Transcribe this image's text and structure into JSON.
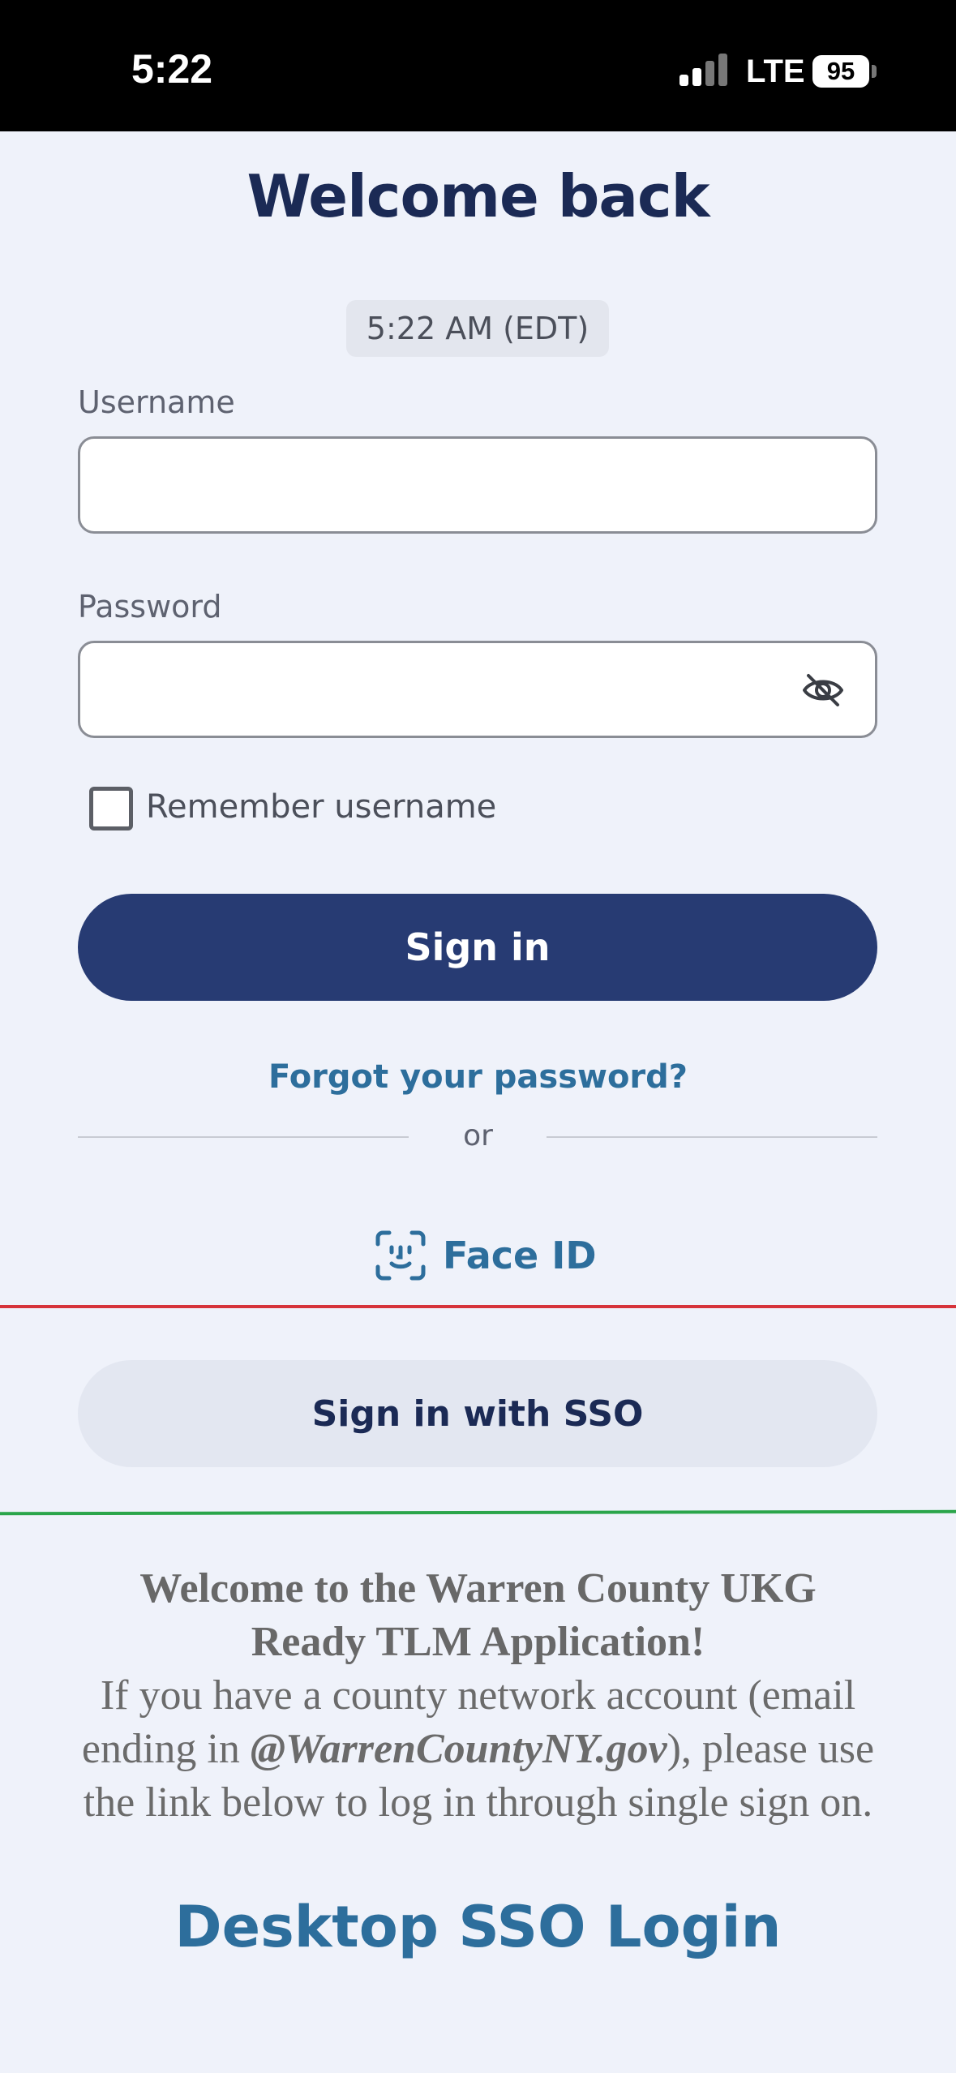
{
  "status_bar": {
    "time": "5:22",
    "network": "LTE",
    "battery": "95"
  },
  "login": {
    "title": "Welcome back",
    "current_time": "5:22 AM (EDT)",
    "username_label": "Username",
    "username_value": "",
    "password_label": "Password",
    "password_value": "",
    "remember_label": "Remember username",
    "remember_checked": false,
    "signin_label": "Sign in",
    "forgot_label": "Forgot your password?",
    "or_label": "or",
    "faceid_label": "Face ID",
    "sso_label": "Sign in with SSO"
  },
  "info": {
    "heading_line1": "Welcome to the Warren County UKG",
    "heading_line2": "Ready TLM Application!",
    "text_before": "If you have a county network account (email ending in ",
    "email_domain": "@WarrenCountyNY.gov",
    "text_after": "), please use the link below to log in through single sign on.",
    "desktop_sso_label": "Desktop SSO Login"
  },
  "colors": {
    "primary": "#273b73",
    "link": "#2d6e9c",
    "background": "#eff2fa",
    "divider_red": "#d6333a",
    "divider_green": "#2aa54a"
  },
  "icons": [
    "signal-icon",
    "battery-icon",
    "eye-off-icon",
    "checkbox-icon",
    "face-id-icon"
  ]
}
